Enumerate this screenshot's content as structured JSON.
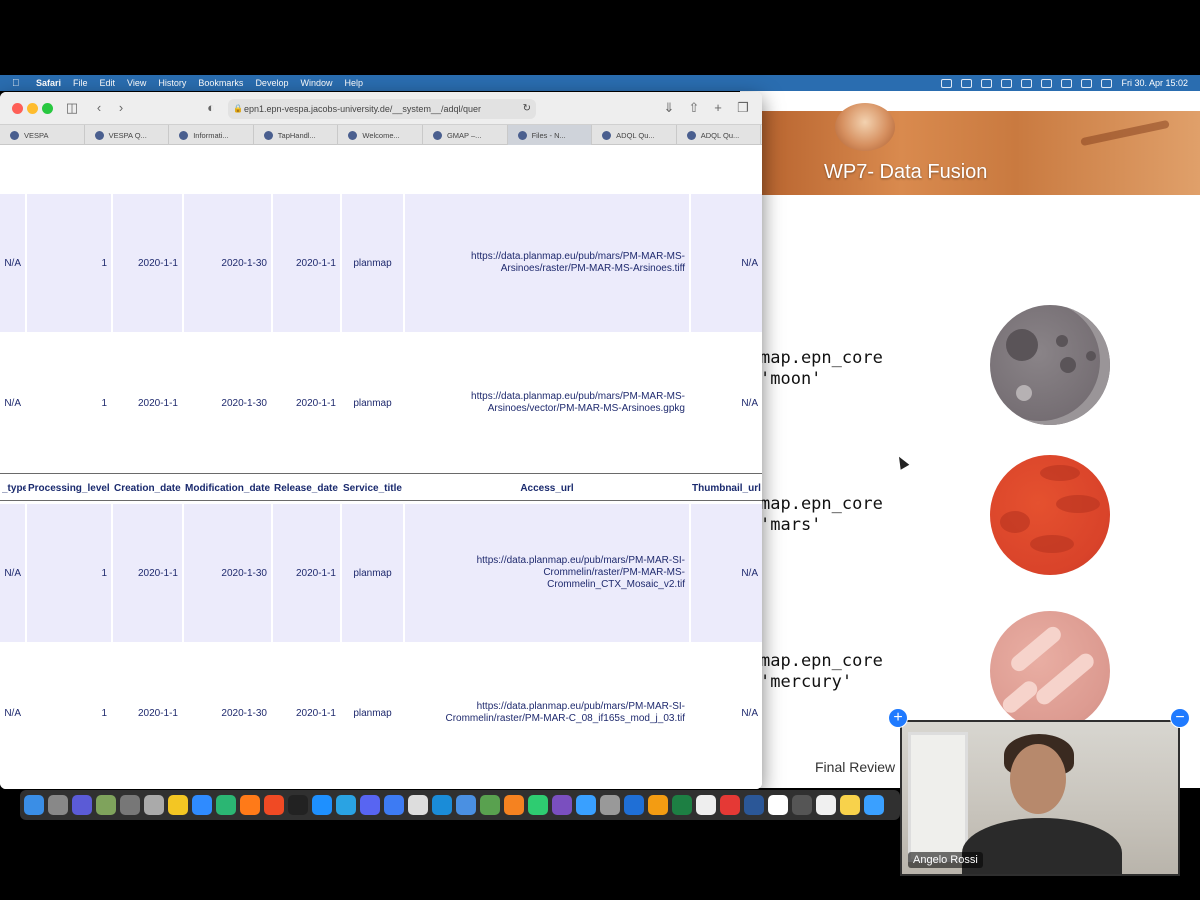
{
  "menubar": {
    "app": "Safari",
    "items": [
      "File",
      "Edit",
      "View",
      "History",
      "Bookmarks",
      "Develop",
      "Window",
      "Help"
    ],
    "clock": "Fri 30. Apr  15:02"
  },
  "safari": {
    "url": "epn1.epn-vespa.jacobs-university.de/__system__/adql/quer",
    "tabs": [
      {
        "label": "VESPA",
        "active": false
      },
      {
        "label": "VESPA Q...",
        "active": false
      },
      {
        "label": "Informati...",
        "active": false
      },
      {
        "label": "TapHandl...",
        "active": false
      },
      {
        "label": "Welcome...",
        "active": false
      },
      {
        "label": "GMAP –...",
        "active": false
      },
      {
        "label": "Files - N...",
        "active": true
      },
      {
        "label": "ADQL Qu...",
        "active": false
      },
      {
        "label": "ADQL Qu...",
        "active": false
      }
    ],
    "table": {
      "headers": [
        "_type",
        "Processing_level",
        "Creation_date",
        "Modification_date",
        "Release_date",
        "Service_title",
        "Access_url",
        "Thumbnail_url"
      ],
      "rows_top": [
        {
          "type": "N/A",
          "level": "1",
          "creation": "2020-1-1",
          "modification": "2020-1-30",
          "release": "2020-1-1",
          "service": "planmap",
          "url": "https://data.planmap.eu/pub/mars/PM-MAR-MS-Arsinoes/raster/PM-MAR-MS-Arsinoes.tiff",
          "url_lines": [
            "https://data.planmap.eu/pub/mars/PM-MAR-MS-",
            "Arsinoes/raster/PM-MAR-MS-Arsinoes.tiff"
          ],
          "thumb": "N/A"
        },
        {
          "type": "N/A",
          "level": "1",
          "creation": "2020-1-1",
          "modification": "2020-1-30",
          "release": "2020-1-1",
          "service": "planmap",
          "url_lines": [
            "https://data.planmap.eu/pub/mars/PM-MAR-MS-",
            "Arsinoes/vector/PM-MAR-MS-Arsinoes.gpkg"
          ],
          "thumb": "N/A"
        }
      ],
      "rows_bottom": [
        {
          "type": "N/A",
          "level": "1",
          "creation": "2020-1-1",
          "modification": "2020-1-30",
          "release": "2020-1-1",
          "service": "planmap",
          "url_lines": [
            "https://data.planmap.eu/pub/mars/PM-MAR-SI-",
            "Crommelin/raster/PM-MAR-MS-",
            "Crommelin_CTX_Mosaic_v2.tif"
          ],
          "thumb": "N/A"
        },
        {
          "type": "N/A",
          "level": "1",
          "creation": "2020-1-1",
          "modification": "2020-1-30",
          "release": "2020-1-1",
          "service": "planmap",
          "url_lines": [
            "https://data.planmap.eu/pub/mars/PM-MAR-SI-",
            "Crommelin/raster/PM-MAR-C_08_if165s_mod_j_03.tif"
          ],
          "thumb": "N/A"
        }
      ]
    }
  },
  "slide": {
    "title": "WP7- Data Fusion",
    "code_lines": [
      {
        "l1": "map.epn_core",
        "l2": "'moon'"
      },
      {
        "l1": "map.epn_core",
        "l2": "'mars'"
      },
      {
        "l1": "map.epn_core",
        "l2": "'mercury'"
      }
    ],
    "footer": "Final Review"
  },
  "video": {
    "name": "Angelo Rossi"
  },
  "colors": {
    "menubar": "#2a6db0",
    "row_shade": "#ecebfb",
    "table_text": "#1f2a6e",
    "zoom_blue": "#1f7aff"
  }
}
